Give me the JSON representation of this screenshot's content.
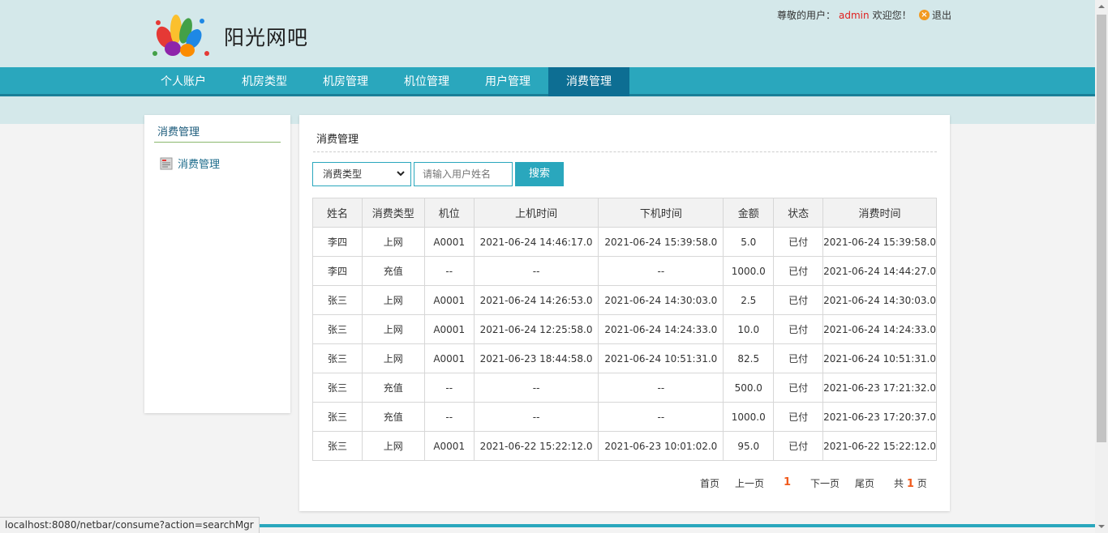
{
  "header": {
    "brand": "阳光网吧",
    "greeting_prefix": "尊敬的用户：",
    "username": "admin",
    "greeting_suffix": "欢迎您！",
    "logout": "退出"
  },
  "nav": {
    "items": [
      "个人账户",
      "机房类型",
      "机房管理",
      "机位管理",
      "用户管理",
      "消费管理"
    ],
    "active_index": 5
  },
  "sidebar": {
    "title": "消费管理",
    "items": [
      {
        "label": "消费管理",
        "icon": "document-icon"
      }
    ]
  },
  "main": {
    "title": "消费管理",
    "filter": {
      "select_value": "消费类型",
      "search_placeholder": "请输入用户姓名",
      "search_button": "搜索"
    },
    "table": {
      "headers": [
        "姓名",
        "消费类型",
        "机位",
        "上机时间",
        "下机时间",
        "金额",
        "状态",
        "消费时间"
      ],
      "rows": [
        [
          "李四",
          "上网",
          "A0001",
          "2021-06-24 14:46:17.0",
          "2021-06-24 15:39:58.0",
          "5.0",
          "已付",
          "2021-06-24 15:39:58.0"
        ],
        [
          "李四",
          "充值",
          "--",
          "--",
          "--",
          "1000.0",
          "已付",
          "2021-06-24 14:44:27.0"
        ],
        [
          "张三",
          "上网",
          "A0001",
          "2021-06-24 14:26:53.0",
          "2021-06-24 14:30:03.0",
          "2.5",
          "已付",
          "2021-06-24 14:30:03.0"
        ],
        [
          "张三",
          "上网",
          "A0001",
          "2021-06-24 12:25:58.0",
          "2021-06-24 14:24:33.0",
          "10.0",
          "已付",
          "2021-06-24 14:24:33.0"
        ],
        [
          "张三",
          "上网",
          "A0001",
          "2021-06-23 18:44:58.0",
          "2021-06-24 10:51:31.0",
          "82.5",
          "已付",
          "2021-06-24 10:51:31.0"
        ],
        [
          "张三",
          "充值",
          "--",
          "--",
          "--",
          "500.0",
          "已付",
          "2021-06-23 17:21:32.0"
        ],
        [
          "张三",
          "充值",
          "--",
          "--",
          "--",
          "1000.0",
          "已付",
          "2021-06-23 17:20:37.0"
        ],
        [
          "张三",
          "上网",
          "A0001",
          "2021-06-22 15:22:12.0",
          "2021-06-23 10:01:02.0",
          "95.0",
          "已付",
          "2021-06-22 15:22:12.0"
        ]
      ]
    },
    "pager": {
      "first": "首页",
      "prev": "上一页",
      "current": "1",
      "next": "下一页",
      "last": "尾页",
      "total_prefix": "共",
      "total": "1",
      "total_suffix": "页"
    }
  },
  "statusbar": {
    "url": "localhost:8080/netbar/consume?action=searchMgr"
  },
  "colors": {
    "accent": "#2aa7bd",
    "nav_active": "#0d6e93",
    "highlight": "#f05a1c",
    "username": "#e0201f"
  }
}
